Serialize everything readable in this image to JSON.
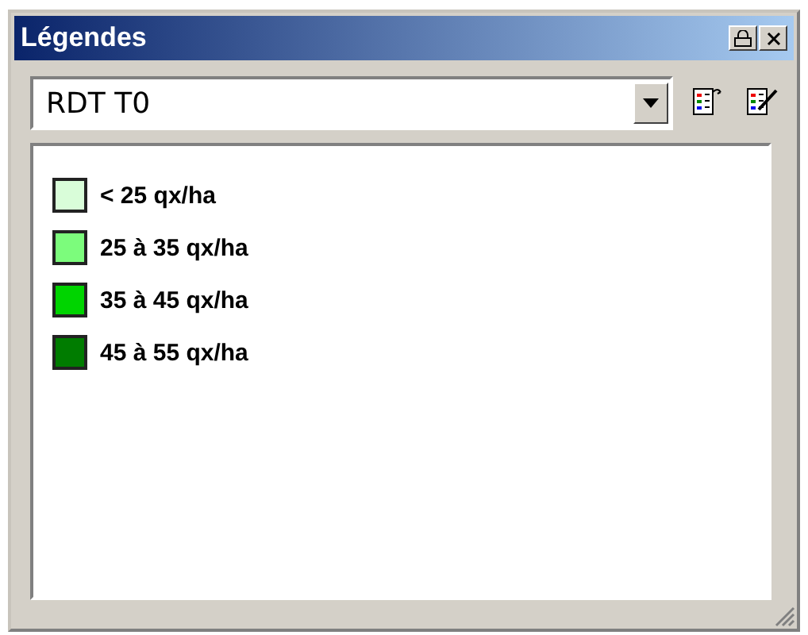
{
  "window": {
    "title": "Légendes"
  },
  "layer_select": {
    "value": "RDT T0"
  },
  "legend": [
    {
      "label": "< 25 qx/ha",
      "color": "#d9fdd9"
    },
    {
      "label": "25 à 35 qx/ha",
      "color": "#7cfc7c"
    },
    {
      "label": "35 à 45 qx/ha",
      "color": "#00d400"
    },
    {
      "label": "45 à 55 qx/ha",
      "color": "#007c00"
    }
  ]
}
